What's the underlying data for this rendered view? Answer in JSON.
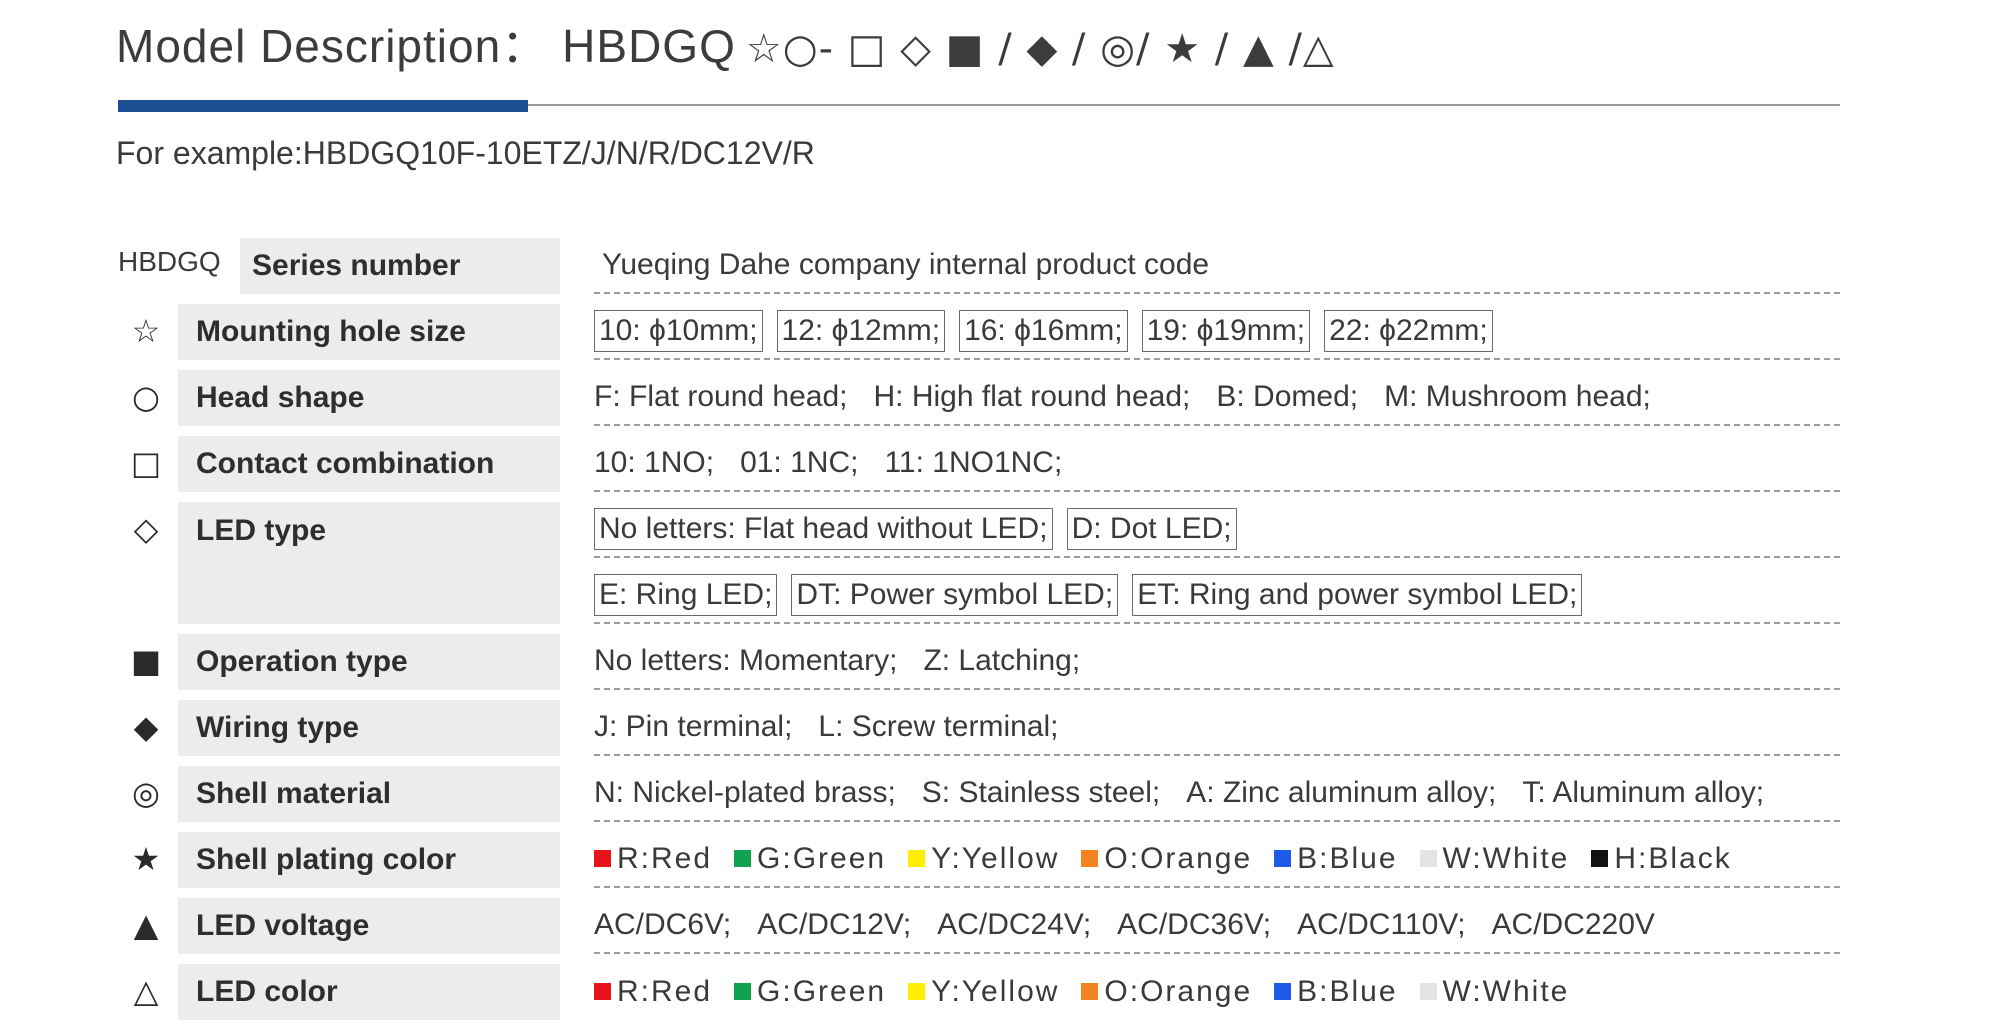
{
  "header": {
    "title": "Model Description：",
    "code": "HBDGQ",
    "symbols": "☆○- □ ◇ ■ / ◆ / ◎/ ★ / ▲ /△",
    "example": "For example:HBDGQ10F-10ETZ/J/N/R/DC12V/R"
  },
  "colors": {
    "accent_blue": "#1a4f93",
    "red": "#e8141c",
    "green": "#12a150",
    "yellow": "#ffee00",
    "orange": "#f58220",
    "blue": "#1e5be6",
    "white": "#e4e4e4",
    "black": "#111111"
  },
  "rows": {
    "series": {
      "code": "HBDGQ",
      "label": "Series number",
      "desc": "Yueqing Dahe company internal product code"
    },
    "mounting": {
      "symbol": "☆",
      "label": "Mounting hole size",
      "options": [
        "10: ϕ10mm;",
        "12: ϕ12mm;",
        "16: ϕ16mm;",
        "19: ϕ19mm;",
        "22: ϕ22mm;"
      ]
    },
    "head": {
      "symbol": "○",
      "label": "Head  shape",
      "options": [
        "F: Flat round head;",
        "H: High flat round head;",
        "B: Domed;",
        "M: Mushroom head;"
      ]
    },
    "contact": {
      "symbol": "□",
      "label": "Contact combination",
      "options": [
        "10: 1NO;",
        "01: 1NC;",
        "11: 1NO1NC;"
      ]
    },
    "led_type": {
      "symbol": "◇",
      "label": "LED type",
      "line1": [
        "No letters: Flat head without LED;",
        "D: Dot LED;"
      ],
      "line2": [
        "E: Ring LED;",
        "DT: Power symbol LED;",
        "ET: Ring and power symbol LED;"
      ]
    },
    "operation": {
      "symbol": "■",
      "label": "Operation type",
      "options": [
        "No letters: Momentary;",
        "Z: Latching;"
      ]
    },
    "wiring": {
      "symbol": "◆",
      "label": "Wiring type",
      "options": [
        "J: Pin terminal;",
        "L: Screw terminal;"
      ]
    },
    "shell": {
      "symbol": "◎",
      "label": "Shell material",
      "options": [
        "N: Nickel-plated brass;",
        "S: Stainless steel;",
        "A: Zinc aluminum alloy;",
        "T: Aluminum alloy;"
      ]
    },
    "plating": {
      "symbol": "★",
      "label": "Shell plating color",
      "options": [
        "R:Red",
        "G:Green",
        "Y:Yellow",
        "O:Orange",
        "B:Blue",
        "W:White",
        "H:Black"
      ]
    },
    "voltage": {
      "symbol": "▲",
      "label": "LED voltage",
      "options": [
        "AC/DC6V;",
        "AC/DC12V;",
        "AC/DC24V;",
        "AC/DC36V;",
        "AC/DC110V;",
        "AC/DC220V"
      ]
    },
    "led_color": {
      "symbol": "△",
      "label": "LED color",
      "options": [
        "R:Red",
        "G:Green",
        "Y:Yellow",
        "O:Orange",
        "B:Blue",
        "W:White"
      ]
    }
  }
}
